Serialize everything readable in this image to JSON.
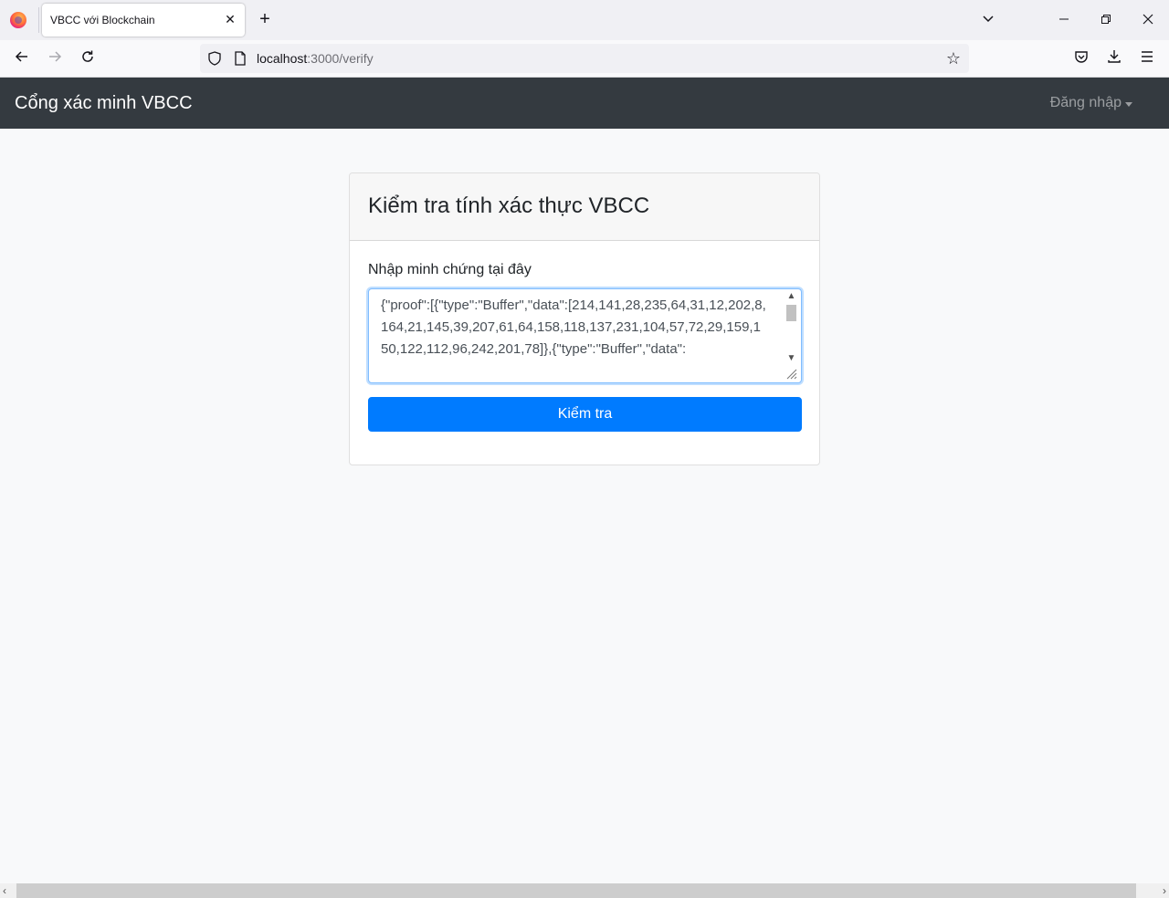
{
  "browser": {
    "tab": {
      "title": "VBCC với Blockchain"
    },
    "url": {
      "host": "localhost",
      "rest": ":3000/verify"
    }
  },
  "site": {
    "brand": "Cổng xác minh VBCC",
    "login": "Đăng nhập"
  },
  "card": {
    "title": "Kiểm tra tính xác thực VBCC",
    "label": "Nhập minh chứng tại đây",
    "proof_value": "{\"proof\":[{\"type\":\"Buffer\",\"data\":[214,141,28,235,64,31,12,202,8,164,21,145,39,207,61,64,158,118,137,231,104,57,72,29,159,150,122,112,96,242,201,78]},{\"type\":\"Buffer\",\"data\":",
    "submit": "Kiểm tra"
  }
}
